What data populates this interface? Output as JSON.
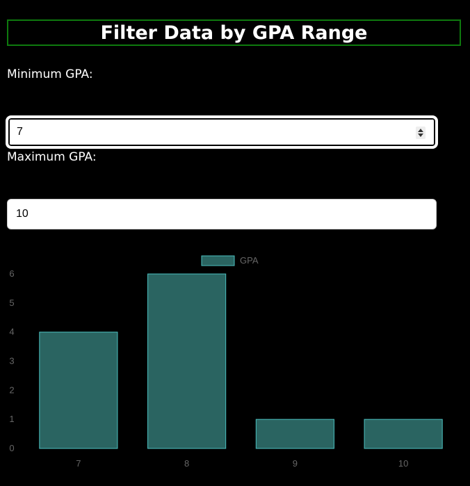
{
  "title": "Filter Data by GPA Range",
  "min_gpa": {
    "label": "Minimum GPA:",
    "value": "7"
  },
  "max_gpa": {
    "label": "Maximum GPA:",
    "value": "10"
  },
  "colors": {
    "title_border": "#0e7a0e",
    "bar_fill": "#2a6461",
    "bar_border": "#4bc0c0",
    "tick_text": "#666666"
  },
  "chart_data": {
    "type": "bar",
    "categories": [
      "7",
      "8",
      "9",
      "10"
    ],
    "series": [
      {
        "name": "GPA",
        "values": [
          4,
          6,
          1,
          1
        ]
      }
    ],
    "ylim": [
      0,
      6
    ],
    "yticks": [
      0,
      1,
      2,
      3,
      4,
      5,
      6
    ],
    "legend": "top-center",
    "grid": false
  }
}
